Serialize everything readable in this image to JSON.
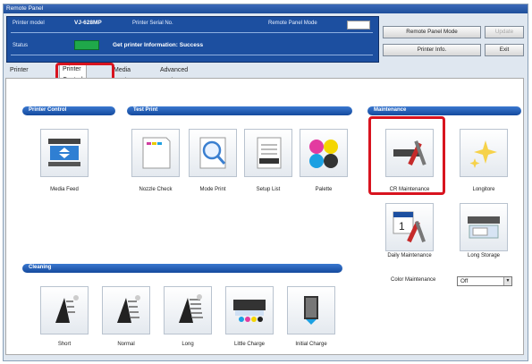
{
  "window": {
    "title": "Remote Panel"
  },
  "status_panel": {
    "printer_model_label": "Printer model",
    "printer_model_value": "VJ-628MP",
    "serial_label": "Printer Serial No.",
    "remote_mode_label": "Remote Panel Mode",
    "status_label": "Status",
    "status_message": "Get printer Information: Success",
    "status_color": "#1fa84a"
  },
  "buttons": {
    "remote_panel_mode": "Remote Panel Mode",
    "update": "Update",
    "printer_info": "Printer Info.",
    "exit": "Exit"
  },
  "tabs": [
    "Printer Status",
    "Printer Control",
    "Media Setting",
    "Advanced Setting"
  ],
  "sections": {
    "printer_control": "Printer Control",
    "test_print": "Test Print",
    "maintenance": "Maintenance",
    "cleaning": "Cleaning"
  },
  "items": {
    "media_feed": "Media Feed",
    "nozzle_check": "Nozzle Check",
    "mode_print": "Mode Print",
    "setup_list": "Setup List",
    "palette": "Palette",
    "cr_maintenance": "CR Maintenance",
    "longitore": "Longitore",
    "daily_maintenance": "Daily Maintenance",
    "long_storage": "Long Storage",
    "short": "Short",
    "normal": "Normal",
    "long": "Long",
    "little_charge": "Little Charge",
    "initial_charge": "Initial Charge"
  },
  "color_maintenance": {
    "label": "Color Maintenance",
    "value": "Off"
  },
  "colors": {
    "accent": "#1c4fa0",
    "highlight": "#d8141f"
  }
}
